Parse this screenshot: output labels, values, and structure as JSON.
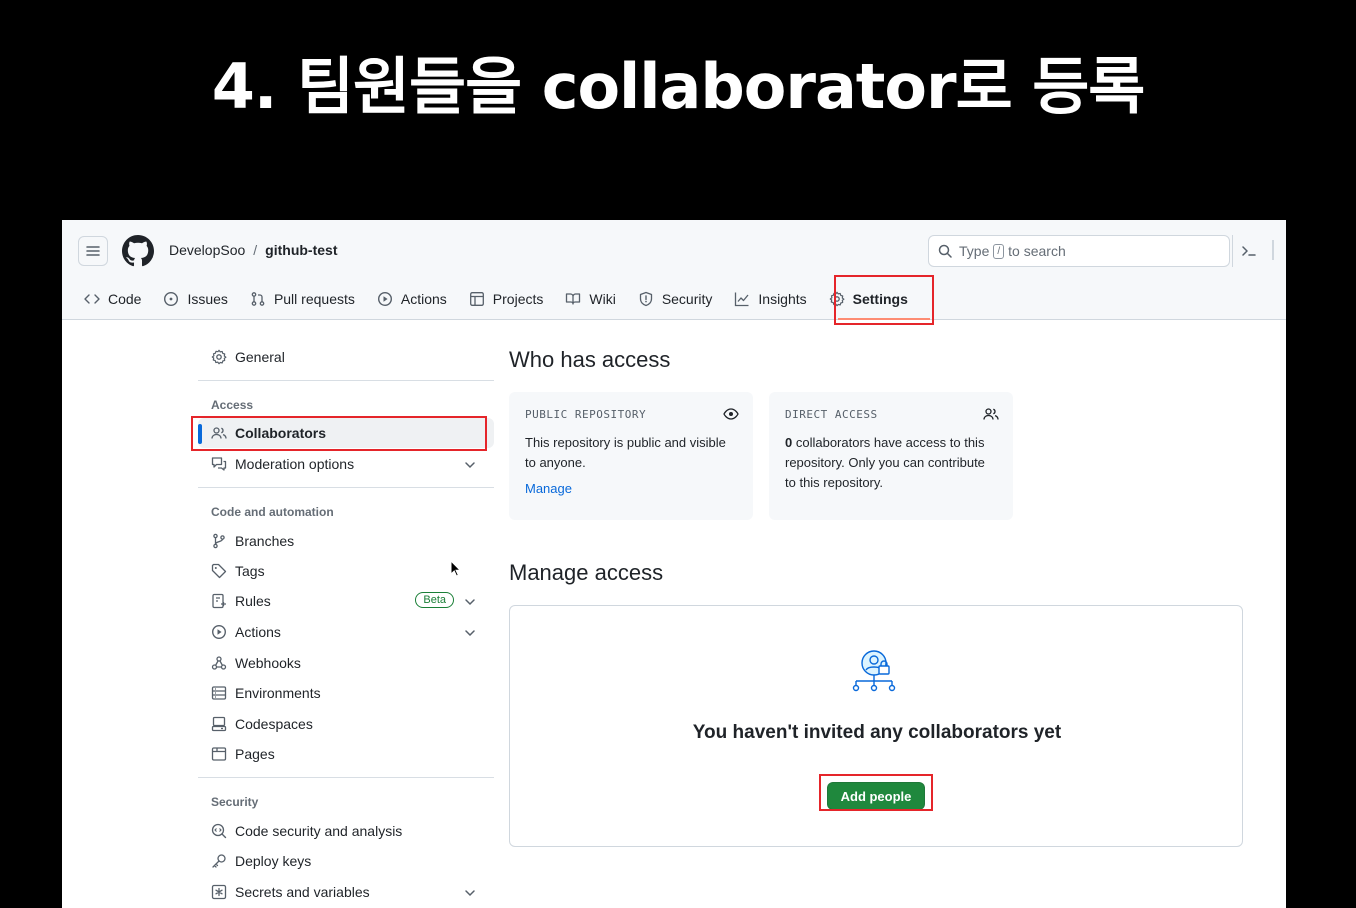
{
  "slide": {
    "title": "4. 팀원들을 collaborator로 등록"
  },
  "header": {
    "owner": "DevelopSoo",
    "separator": "/",
    "repo": "github-test",
    "search_before": "Type",
    "search_key": "/",
    "search_after": "to search"
  },
  "tabs": [
    {
      "label": "Code",
      "icon": "code-icon"
    },
    {
      "label": "Issues",
      "icon": "issue-icon"
    },
    {
      "label": "Pull requests",
      "icon": "pull-request-icon"
    },
    {
      "label": "Actions",
      "icon": "play-icon"
    },
    {
      "label": "Projects",
      "icon": "table-icon"
    },
    {
      "label": "Wiki",
      "icon": "book-icon"
    },
    {
      "label": "Security",
      "icon": "shield-icon"
    },
    {
      "label": "Insights",
      "icon": "graph-icon"
    },
    {
      "label": "Settings",
      "icon": "gear-icon",
      "active": true
    }
  ],
  "sidebar": {
    "general": "General",
    "access_heading": "Access",
    "collaborators": "Collaborators",
    "moderation": "Moderation options",
    "code_heading": "Code and automation",
    "branches": "Branches",
    "tags": "Tags",
    "rules": "Rules",
    "beta": "Beta",
    "actions": "Actions",
    "webhooks": "Webhooks",
    "environments": "Environments",
    "codespaces": "Codespaces",
    "pages": "Pages",
    "security_heading": "Security",
    "code_security": "Code security and analysis",
    "deploy_keys": "Deploy keys",
    "secrets": "Secrets and variables"
  },
  "main": {
    "who_title": "Who has access",
    "public_card": {
      "label": "PUBLIC REPOSITORY",
      "text": "This repository is public and visible to anyone.",
      "link": "Manage"
    },
    "direct_card": {
      "label": "DIRECT ACCESS",
      "count": "0",
      "text": " collaborators have access to this repository. Only you can contribute to this repository."
    },
    "manage_title": "Manage access",
    "empty_text": "You haven't invited any collaborators yet",
    "add_button": "Add people"
  },
  "colors": {
    "highlight": "#e5252a",
    "primary_button": "#1f883d",
    "link": "#0969da",
    "active_bar": "#0969da",
    "tab_underline": "#fd8c73"
  }
}
